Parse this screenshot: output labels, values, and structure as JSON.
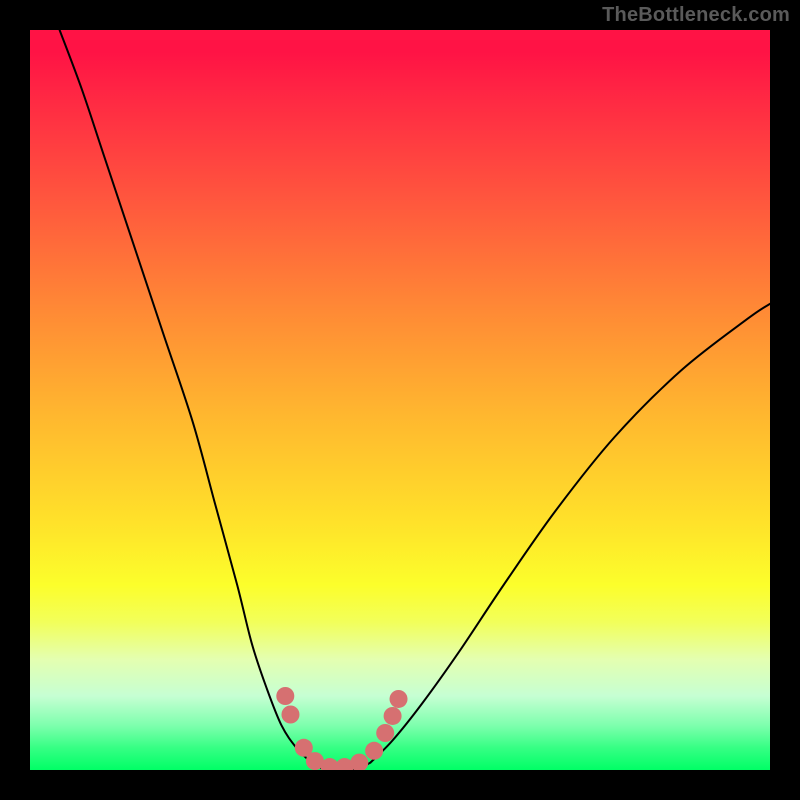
{
  "watermark": "TheBottleneck.com",
  "chart_data": {
    "type": "line",
    "title": "",
    "xlabel": "",
    "ylabel": "",
    "xlim": [
      0,
      100
    ],
    "ylim": [
      0,
      100
    ],
    "grid": false,
    "legend": false,
    "gradient_stops": [
      {
        "pos": 0,
        "color": "#ff1345"
      },
      {
        "pos": 10,
        "color": "#ff2b43"
      },
      {
        "pos": 24,
        "color": "#ff5a3d"
      },
      {
        "pos": 38,
        "color": "#ff8a35"
      },
      {
        "pos": 52,
        "color": "#ffb72f"
      },
      {
        "pos": 66,
        "color": "#ffe02a"
      },
      {
        "pos": 75,
        "color": "#fcfe2b"
      },
      {
        "pos": 85,
        "color": "#e4ffb0"
      },
      {
        "pos": 94,
        "color": "#7dffad"
      },
      {
        "pos": 100,
        "color": "#00ff66"
      }
    ],
    "series": [
      {
        "name": "left-branch",
        "x": [
          4,
          7,
          10,
          14,
          18,
          22,
          25,
          28,
          30,
          32,
          34,
          36,
          38
        ],
        "values": [
          100,
          92,
          83,
          71,
          59,
          47,
          36,
          25,
          17,
          11,
          6,
          3,
          1
        ]
      },
      {
        "name": "valley-floor",
        "x": [
          38,
          40,
          42,
          44,
          46
        ],
        "values": [
          1,
          0,
          0,
          0,
          1
        ]
      },
      {
        "name": "right-branch",
        "x": [
          46,
          49,
          53,
          58,
          64,
          71,
          79,
          88,
          97,
          100
        ],
        "values": [
          1,
          4,
          9,
          16,
          25,
          35,
          45,
          54,
          61,
          63
        ]
      }
    ],
    "markers": {
      "name": "valley-markers",
      "color": "#d67071",
      "points": [
        {
          "x": 34.5,
          "y": 10.0
        },
        {
          "x": 35.2,
          "y": 7.5
        },
        {
          "x": 37.0,
          "y": 3.0
        },
        {
          "x": 38.5,
          "y": 1.2
        },
        {
          "x": 40.5,
          "y": 0.4
        },
        {
          "x": 42.5,
          "y": 0.4
        },
        {
          "x": 44.5,
          "y": 1.0
        },
        {
          "x": 46.5,
          "y": 2.6
        },
        {
          "x": 48.0,
          "y": 5.0
        },
        {
          "x": 49.0,
          "y": 7.3
        },
        {
          "x": 49.8,
          "y": 9.6
        }
      ]
    }
  }
}
